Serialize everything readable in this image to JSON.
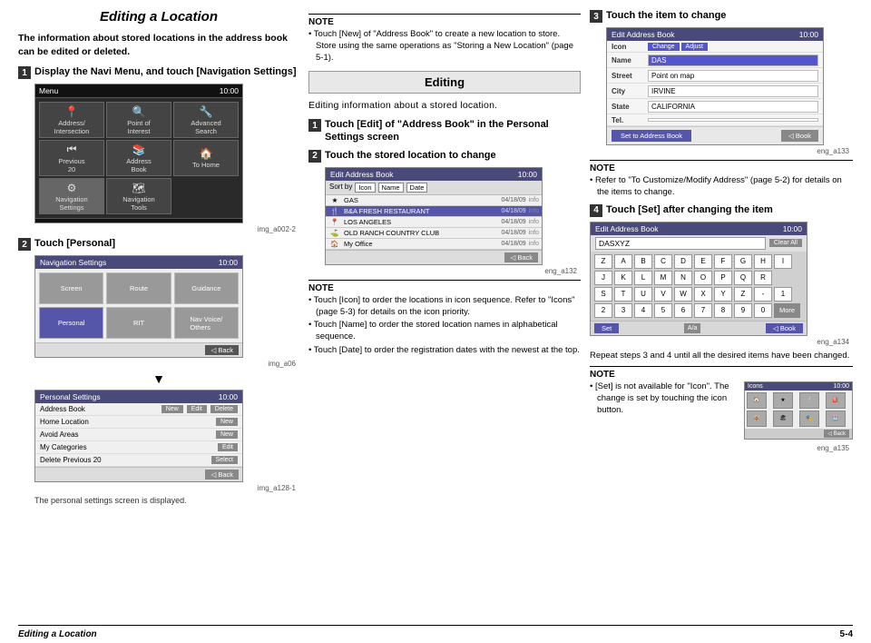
{
  "page": {
    "title": "Editing a Location",
    "subtitle": "Editing",
    "intro": "The information about stored locations in the address book can be edited or deleted.",
    "footer_left": "Editing a Location",
    "footer_right": "5-4"
  },
  "steps": {
    "step1_left": {
      "num": "1",
      "label": "Display the Navi Menu, and touch [Navigation Settings]"
    },
    "step2_left": {
      "num": "2",
      "label": "Touch [Personal]"
    },
    "caption_left": "The personal settings screen is displayed.",
    "step1_mid": {
      "num": "1",
      "label": "Touch [Edit] of \"Address Book\" in the Personal Settings screen"
    },
    "step2_mid": {
      "num": "2",
      "label": "Touch the stored location to change"
    },
    "step3_right": {
      "num": "3",
      "label": "Touch the item to change"
    },
    "step4_right": {
      "num": "4",
      "label": "Touch [Set] after changing the item"
    }
  },
  "notes": {
    "mid_top": {
      "title": "NOTE",
      "items": [
        "Touch [New] of \"Address Book\" to create a new location to store. Store using the same operations as \"Storing a New Location\" (page 5-1)."
      ]
    },
    "mid_bottom": {
      "title": "NOTE",
      "items": [
        "Touch [Icon] to order the locations in icon sequence. Refer to \"Icons\" (page 5-3) for details on the icon priority.",
        "Touch [Name] to order the stored location names in alphabetical sequence.",
        "Touch [Date] to order the registration dates with the newest at the top."
      ]
    },
    "right_top": {
      "title": "NOTE",
      "items": [
        "Refer to \"To Customize/Modify Address\" (page 5-2) for details on the items to change."
      ]
    },
    "right_bottom_text": "Repeat steps 3 and 4 until all the desired items have been changed.",
    "right_bottom": {
      "title": "NOTE",
      "items": [
        "[Set] is not available for \"Icon\". The change is set by touching the icon button."
      ]
    }
  },
  "screens": {
    "navi_menu": {
      "title": "Menu",
      "time": "10:00",
      "caption": "img_a002-2"
    },
    "navi_settings": {
      "title": "Navigation Settings",
      "time": "10:00",
      "caption": "img_a06"
    },
    "personal_settings": {
      "title": "Personal Settings",
      "time": "10:00",
      "caption": "img_a128-1",
      "rows": [
        {
          "label": "Address Book",
          "btns": [
            "New",
            "Edit",
            "Delete"
          ]
        },
        {
          "label": "Home Location",
          "btns": [
            "New"
          ]
        },
        {
          "label": "Avoid Areas",
          "btns": [
            "New"
          ]
        },
        {
          "label": "My Categories",
          "btns": [
            "Edit"
          ]
        },
        {
          "label": "Delete Previous 20",
          "btns": [
            "Select"
          ]
        }
      ]
    },
    "address_book_list": {
      "title": "Edit Address Book",
      "time": "10:00",
      "caption": "eng_a132",
      "sort_labels": [
        "Sort by",
        "Icon",
        "Name",
        "Date"
      ],
      "rows": [
        {
          "icon": "★",
          "name": "GAS",
          "date": "04/18/09",
          "info": "info"
        },
        {
          "icon": "🍴",
          "name": "B&A FRESH RESTAURANT",
          "date": "04/18/09",
          "info": "info",
          "selected": true
        },
        {
          "icon": "🏌",
          "name": "LOS ANGELES",
          "date": "04/18/09",
          "info": "info"
        },
        {
          "icon": "⛳",
          "name": "OLD RANCH COUNTRY CLUB",
          "date": "04/18/09",
          "info": "info"
        },
        {
          "icon": "🏠",
          "name": "My Office",
          "date": "04/18/09",
          "info": "info"
        }
      ]
    },
    "edit_address_book": {
      "title": "Edit Address Book",
      "time": "10:00",
      "caption": "eng_a133",
      "rows": [
        {
          "label": "Icon",
          "value": "Change",
          "extra": "Adjust"
        },
        {
          "label": "Name",
          "value": "DAS"
        },
        {
          "label": "Street",
          "value": "Point on map"
        },
        {
          "label": "City",
          "value": "IRVINE"
        },
        {
          "label": "State",
          "value": "CALIFORNIA"
        },
        {
          "label": "Tel.",
          "value": ""
        }
      ],
      "bottom_btn": "Set to Address Book"
    },
    "keyboard": {
      "title": "Edit Address Book",
      "time": "10:00",
      "caption": "eng_a134",
      "input_value": "DASXYZ",
      "keys_row1": [
        "1",
        "2",
        "3",
        "4",
        "5",
        "6",
        "7",
        "8",
        "9",
        "0"
      ],
      "keys_row2": [
        "A",
        "B",
        "C",
        "D",
        "E",
        "F",
        "G",
        "H",
        "I"
      ],
      "keys_row3": [
        "J",
        "K",
        "L",
        "M",
        "N",
        "O",
        "P",
        "Q",
        "R"
      ],
      "keys_row4": [
        "S",
        "T",
        "U",
        "V",
        "W",
        "X",
        "Y",
        "Z",
        "-"
      ]
    },
    "icon_select": {
      "title": "Icons",
      "time": "10:00",
      "caption": "eng_a135"
    }
  }
}
